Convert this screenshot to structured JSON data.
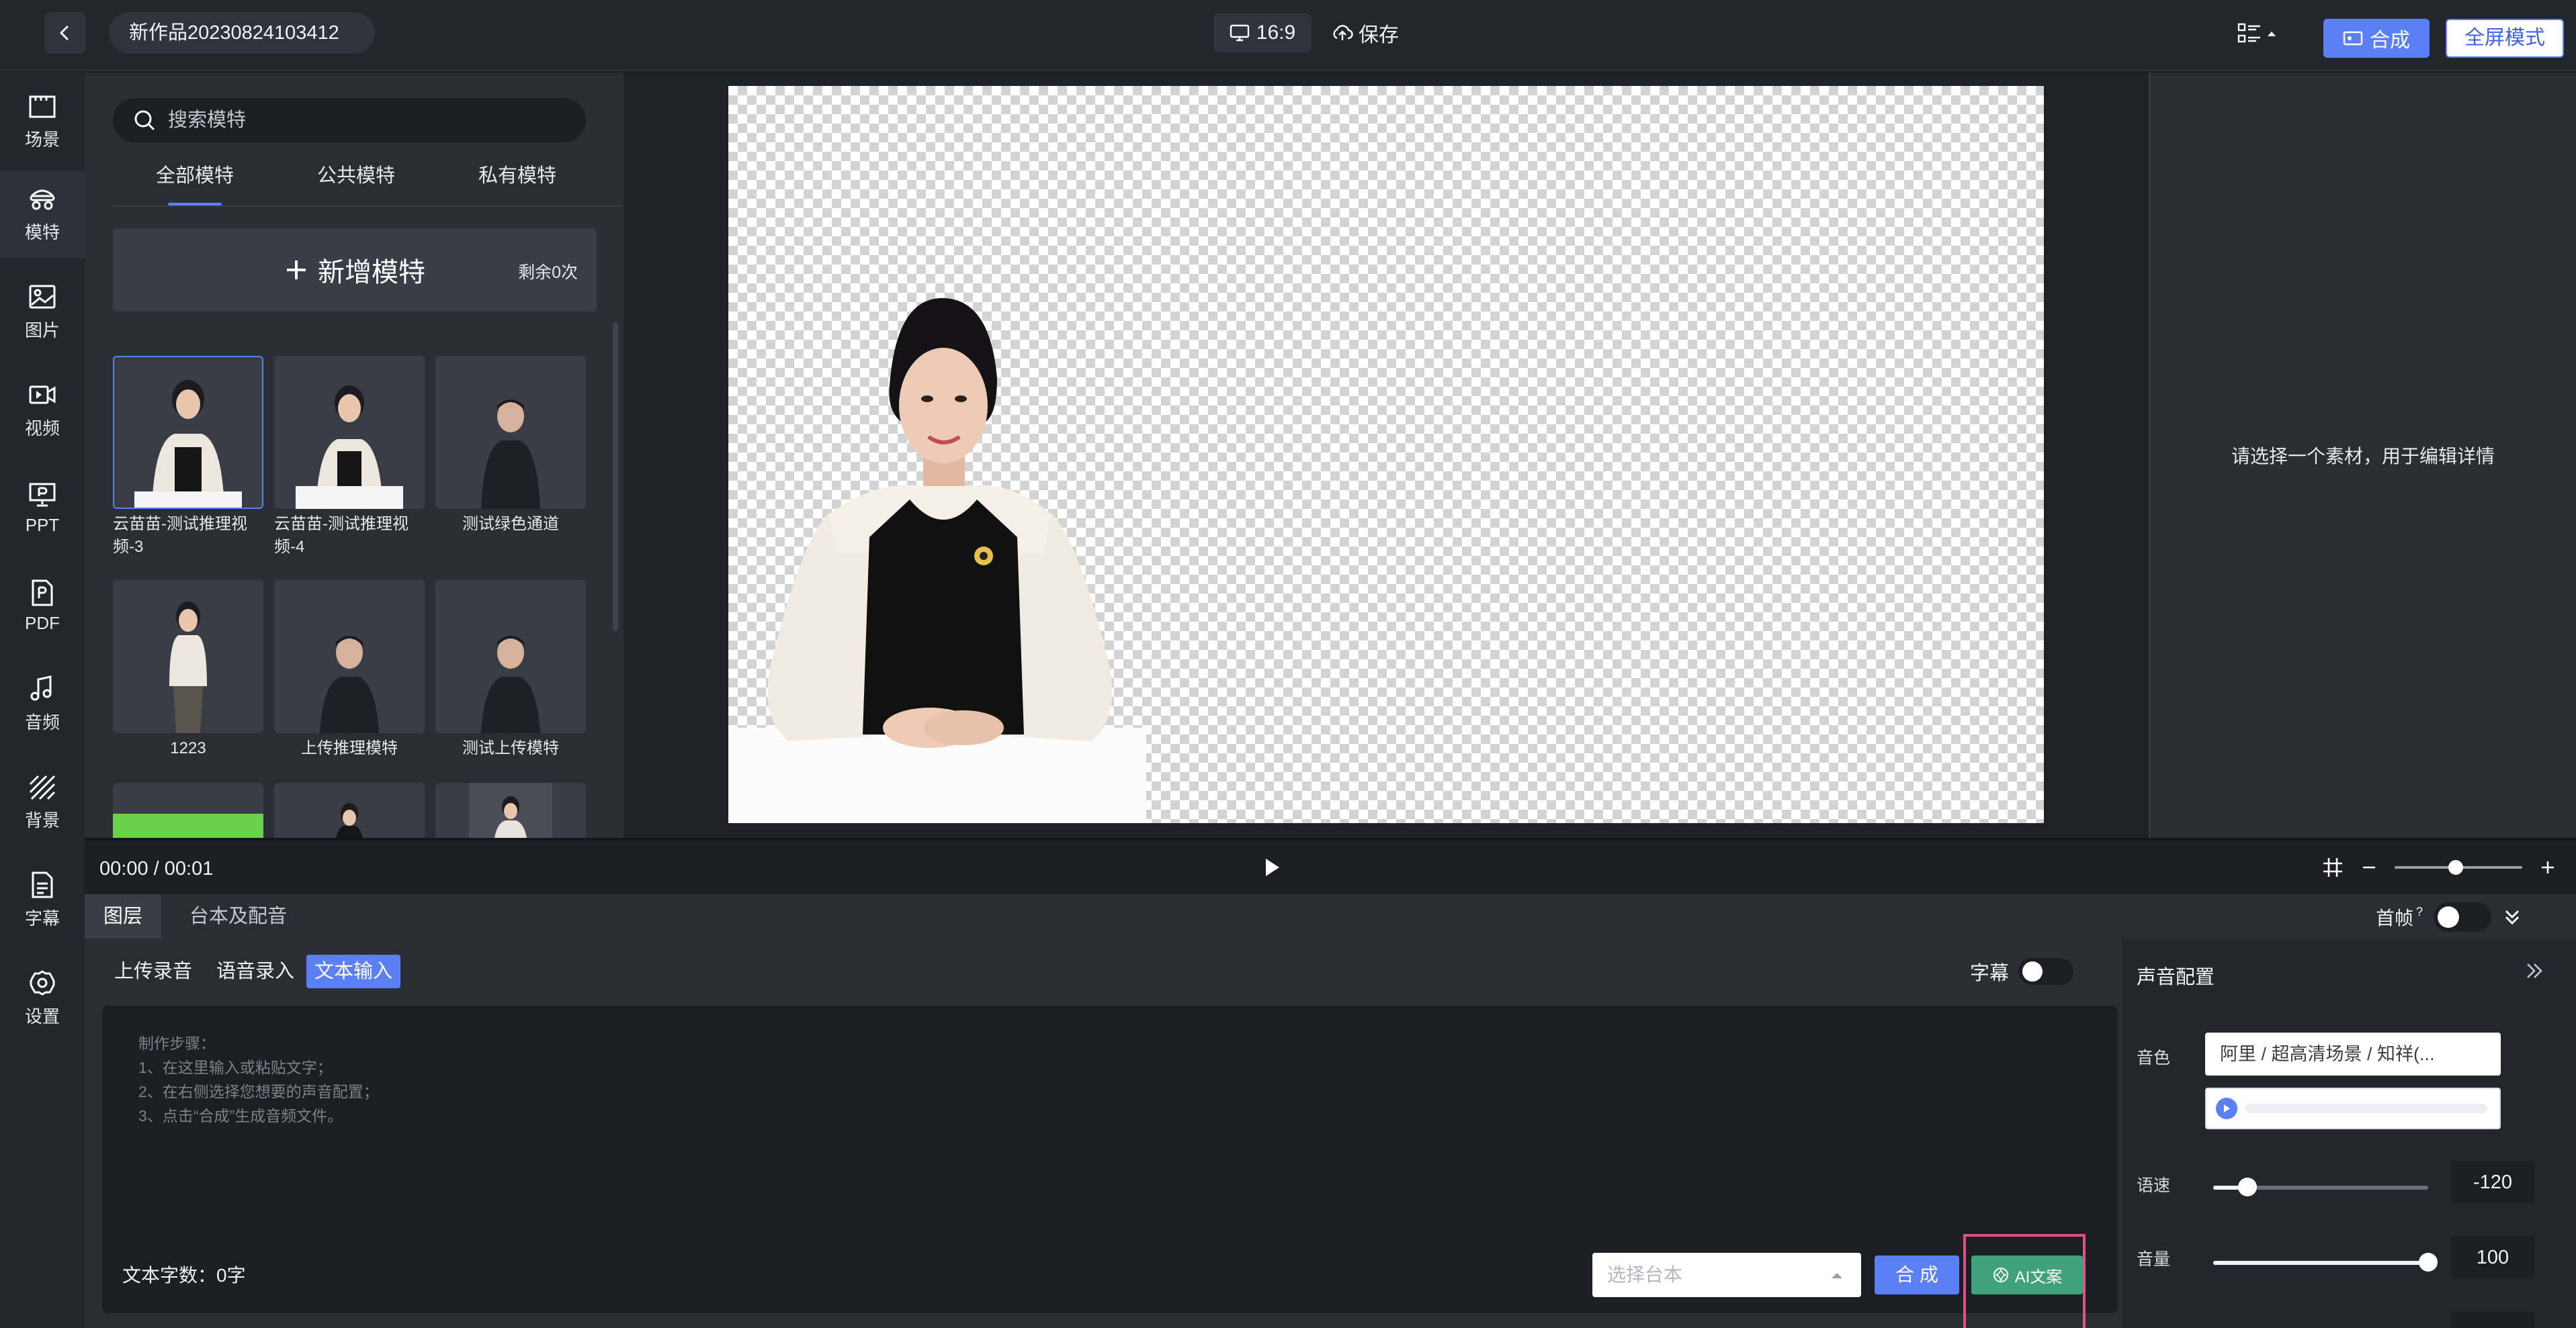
{
  "header": {
    "project_name": "新作品20230824103412",
    "aspect_ratio": "16:9",
    "save_label": "保存",
    "compose_label": "合成",
    "fullscreen_label": "全屏模式"
  },
  "sidebar": {
    "items": [
      {
        "label": "场景",
        "icon": "scene-icon"
      },
      {
        "label": "模特",
        "icon": "model-icon"
      },
      {
        "label": "图片",
        "icon": "image-icon"
      },
      {
        "label": "视频",
        "icon": "video-icon"
      },
      {
        "label": "PPT",
        "icon": "ppt-icon"
      },
      {
        "label": "PDF",
        "icon": "pdf-icon"
      },
      {
        "label": "音频",
        "icon": "music-icon"
      },
      {
        "label": "背景",
        "icon": "background-icon"
      },
      {
        "label": "字幕",
        "icon": "subtitle-icon"
      },
      {
        "label": "设置",
        "icon": "gear-icon"
      }
    ],
    "active_index": 1
  },
  "model_panel": {
    "search_placeholder": "搜索模特",
    "tabs": [
      "全部模特",
      "公共模特",
      "私有模特"
    ],
    "active_tab": 0,
    "add_label": "新增模特",
    "remaining": "剩余0次",
    "models": [
      {
        "name": "云苗苗-测试推理视频-3",
        "type": "female",
        "selected": true
      },
      {
        "name": "云苗苗-测试推理视频-4",
        "type": "female-seated",
        "selected": false
      },
      {
        "name": "测试绿色通道",
        "type": "male",
        "selected": false
      },
      {
        "name": "1223",
        "type": "female-standing",
        "selected": false
      },
      {
        "name": "上传推理模特",
        "type": "male",
        "selected": false
      },
      {
        "name": "测试上传模特",
        "type": "male",
        "selected": false
      }
    ]
  },
  "detail_panel": {
    "hint": "请选择一个素材，用于编辑详情"
  },
  "timeline": {
    "current": "00:00",
    "separator": "/",
    "total": "00:01"
  },
  "bottom_tabs": {
    "layers": "图层",
    "script": "台本及配音",
    "first_frame": "首帧",
    "first_frame_help": "?"
  },
  "editor": {
    "modes": [
      "上传录音",
      "语音录入",
      "文本输入"
    ],
    "active_mode": 2,
    "subtitle_label": "字幕",
    "steps": [
      "制作步骤：",
      "1、在这里输入或粘贴文字；",
      "2、在右侧选择您想要的声音配置；",
      "3、点击“合成”生成音频文件。"
    ],
    "char_count_label": "文本字数：0字",
    "script_select_placeholder": "选择台本",
    "synthesize_label": "合 成",
    "ai_label": "AI文案"
  },
  "voice_config": {
    "title": "声音配置",
    "timbre_label": "音色",
    "timbre_value": "阿里 / 超高清场景 / 知祥(...",
    "speed_label": "语速",
    "speed_value": "-120",
    "speed_level": 0.16,
    "volume_label": "音量",
    "volume_value": "100",
    "volume_level": 1.0
  },
  "colors": {
    "accent": "#5b7ff5",
    "ai_button": "#3fa27a",
    "highlight": "#e0518a"
  }
}
